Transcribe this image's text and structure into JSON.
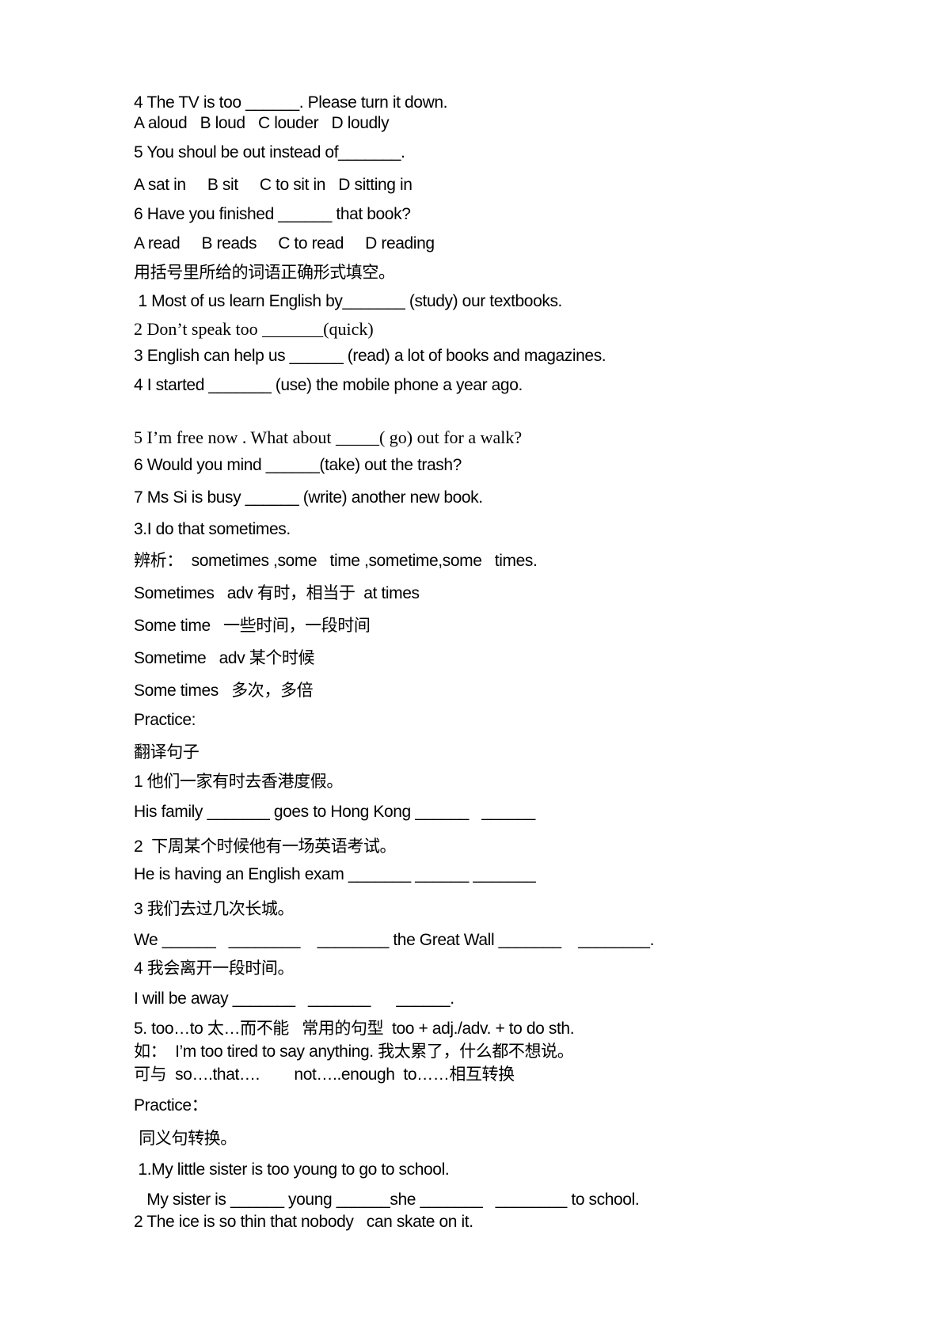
{
  "lines": [
    "4 The TV is too ______. Please turn it down.",
    "A aloud   B loud   C louder   D loudly",
    "5 You shoul be out instead of_______.",
    "A sat in     B sit     C to sit in   D sitting in",
    "6 Have you finished ______ that book?",
    "A read     B reads     C to read     D reading",
    "用括号里所给的词语正确形式填空。",
    " 1 Most of us learn English by_______ (study) our textbooks.",
    "2 Don’t speak too _______(quick)",
    "3 English can help us ______ (read) a lot of books and magazines.",
    "4 I started _______ (use) the mobile phone a year ago.",
    "5 I’m free now . What about _____( go) out for a walk?",
    "6 Would you mind ______(take) out the trash?",
    "7 Ms Si is busy ______ (write) another new book.",
    "3.I do that sometimes.",
    "辨析：  sometimes ,some   time ,sometime,some   times.",
    "Sometimes   adv 有时，相当于  at times",
    "Some time   一些时间，一段时间",
    "Sometime   adv 某个时候",
    "Some times   多次，多倍",
    "Practice:",
    "翻译句子",
    "1 他们一家有时去香港度假。",
    "His family _______ goes to Hong Kong ______   ______",
    "2  下周某个时候他有一场英语考试。",
    "He is having an English exam _______ ______ _______",
    "3 我们去过几次长城。",
    "We ______   ________    ________ the Great Wall _______    ________.",
    "4 我会离开一段时间。",
    "I will be away _______   _______      ______.",
    "5. too…to 太…而不能   常用的句型  too + adj./adv. + to do sth.",
    "如：  I’m too tired to say anything. 我太累了，什么都不想说。",
    "可与  so….that….        not…..enough  to……相互转换",
    "Practice：",
    " 同义句转换。",
    " 1.My little sister is too young to go to school.",
    "   My sister is ______ young ______she _______   ________ to school.",
    "2 The ice is so thin that nobody   can skate on it."
  ]
}
